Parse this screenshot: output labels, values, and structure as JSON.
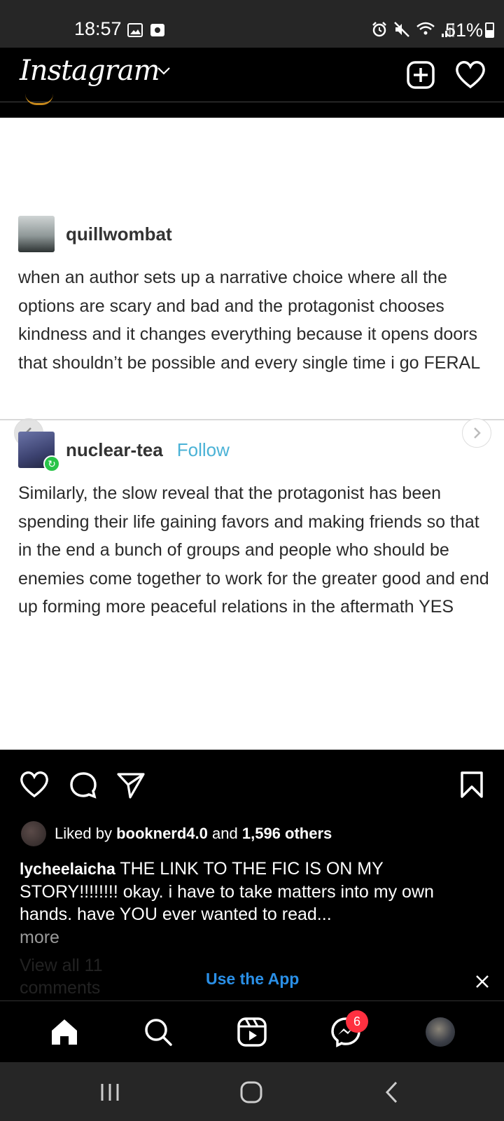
{
  "status_bar": {
    "time": "18:57",
    "battery": "51%"
  },
  "app_bar": {
    "logo": "Instagram"
  },
  "post": {
    "tumblr_posts": [
      {
        "username": "quillwombat",
        "text": "when an author sets up a narrative choice where all the options are scary and bad and the protagonist chooses kindness and it changes everything because it opens doors that shouldn’t be possible and every single time i go FERAL"
      },
      {
        "username": "nuclear-tea",
        "follow": "Follow",
        "text": "Similarly, the slow reveal that the protagonist has been spending their life gaining favors and making friends so that in the end a bunch of groups and people who should be enemies come together to work for the greater good and end up forming more peaceful relations in the aftermath YES"
      }
    ],
    "likes": {
      "prefix": "Liked by",
      "user": "booknerd4.0",
      "and": "and",
      "others": "1,596 others"
    },
    "caption": {
      "username": "lycheelaicha",
      "text": "THE LINK TO THE FIC IS ON MY STORY!!!!!!!! okay. i have to take matters into my own hands. have YOU ever wanted to read..."
    },
    "more": "more",
    "view_comments": "View all 11 comments"
  },
  "banner": {
    "label": "Use the App"
  },
  "bottom_nav": {
    "messages_badge": "6"
  },
  "colors": {
    "link_blue": "#2a8fe6",
    "badge_red": "#ff3040",
    "tumblr_follow": "#4ab2d6"
  }
}
